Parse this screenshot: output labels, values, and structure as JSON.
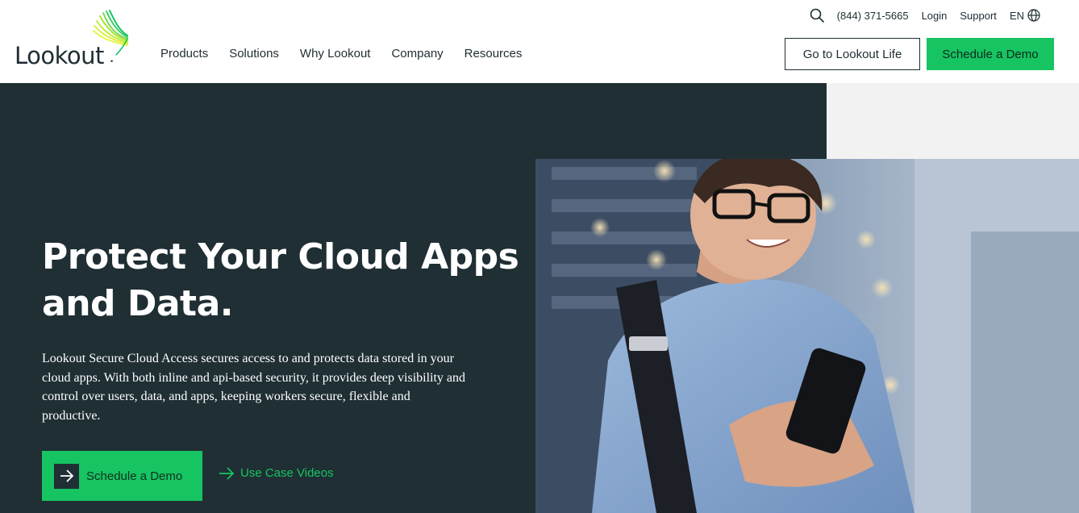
{
  "header": {
    "logo_text": "Lookout",
    "nav": [
      "Products",
      "Solutions",
      "Why Lookout",
      "Company",
      "Resources"
    ],
    "utility": {
      "phone": "(844) 371-5665",
      "login": "Login",
      "support": "Support",
      "language": "EN"
    },
    "btn_life": "Go to Lookout Life",
    "btn_demo": "Schedule a Demo"
  },
  "hero": {
    "title": "Protect Your Cloud Apps and Data.",
    "description": "Lookout Secure Cloud Access secures access to and protects data stored in your cloud apps. With both inline and api-based security, it provides deep visibility and control over users, data, and apps, keeping workers secure, flexible and productive.",
    "cta_primary": "Schedule a Demo",
    "cta_secondary": "Use Case Videos"
  },
  "colors": {
    "brand_green": "#16c462",
    "hero_bg": "#1f2f34",
    "text_dark": "#1f2d33"
  },
  "icons": [
    "search-icon",
    "globe-icon",
    "arrow-right-icon"
  ]
}
